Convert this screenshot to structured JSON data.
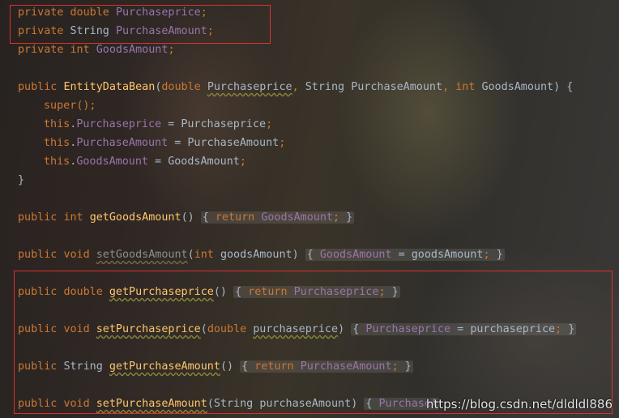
{
  "code": {
    "line1": {
      "k1": "private",
      "k2": "double",
      "field": "Purchaseprice",
      "semi": ";"
    },
    "line2": {
      "k1": "private",
      "t": "String",
      "field": "PurchaseAmount",
      "semi": ";"
    },
    "line3": {
      "k1": "private",
      "k2": "int",
      "field": "GoodsAmount",
      "semi": ";"
    },
    "ctor": {
      "k1": "public",
      "name": "EntityDataBean",
      "open": "(",
      "p1t": "double",
      "p1n": "Purchaseprice",
      "comma1": ",",
      "p2t": "String",
      "p2n": "PurchaseAmount",
      "comma2": ",",
      "p3t": "int",
      "p3n": "GoodsAmount",
      "close": ") {",
      "super": "super",
      "super_rest": "();",
      "this1": "this",
      "dot": ".",
      "f1": "Purchaseprice",
      "eq1": " = ",
      "v1": "Purchaseprice",
      "s": ";",
      "f2": "PurchaseAmount",
      "v2": "PurchaseAmount",
      "f3": "GoodsAmount",
      "v3": "GoodsAmount",
      "end": "}"
    },
    "getGoods": {
      "k1": "public",
      "k2": "int",
      "name": "getGoodsAmount",
      "paren": "()",
      "ob": "{",
      "ret": "return",
      "field": "GoodsAmount",
      "semi": ";",
      "cb": "}"
    },
    "setGoods": {
      "k1": "public",
      "k2": "void",
      "name": "setGoodsAmount",
      "open": "(",
      "pt": "int",
      "pn": "goodsAmount",
      "close": ")",
      "ob": "{",
      "field": "GoodsAmount",
      "eq": " = ",
      "val": "goodsAmount",
      "semi": ";",
      "cb": "}"
    },
    "getPrice": {
      "k1": "public",
      "k2": "double",
      "name": "getPurchaseprice",
      "paren": "()",
      "ob": "{",
      "ret": "return",
      "field": "Purchaseprice",
      "semi": ";",
      "cb": "}"
    },
    "setPrice": {
      "k1": "public",
      "k2": "void",
      "name": "setPurchaseprice",
      "open": "(",
      "pt": "double",
      "pn": "purchaseprice",
      "close": ")",
      "ob": "{",
      "field": "Purchaseprice",
      "eq": " = ",
      "val": "purchaseprice",
      "semi": ";",
      "cb": "}"
    },
    "getAmount": {
      "k1": "public",
      "t": "String",
      "name": "getPurchaseAmount",
      "paren": "()",
      "ob": "{",
      "ret": "return",
      "field": "PurchaseAmount",
      "semi": ";",
      "cb": "}"
    },
    "setAmount": {
      "k1": "public",
      "k2": "void",
      "name": "setPurchaseAmount",
      "open": "(",
      "pt": "String",
      "pn": "purchaseAmount",
      "close": ")",
      "ob": "{",
      "field": "PurchaseA"
    }
  },
  "watermark": "https://blog.csdn.net/dldldl886"
}
